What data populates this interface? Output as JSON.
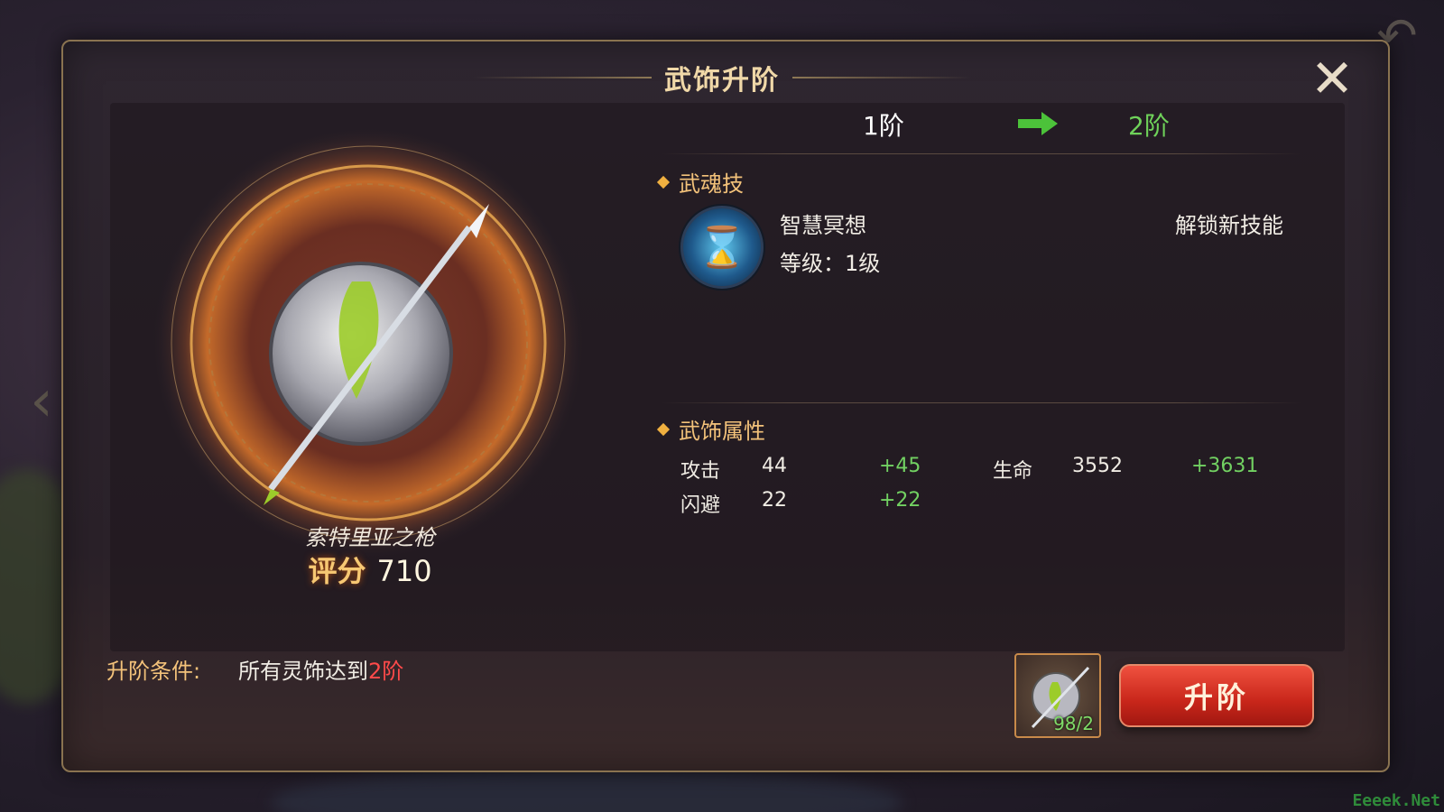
{
  "title": "武饰升阶",
  "stage": {
    "from": "1阶",
    "to": "2阶"
  },
  "item": {
    "name": "索特里亚之枪",
    "score_label": "评分",
    "score_value": "710"
  },
  "skill_section": {
    "heading": "武魂技",
    "skill_name": "智慧冥想",
    "skill_level": "等级：1级",
    "unlock_text": "解锁新技能",
    "icon": "hourglass-icon"
  },
  "attr_section": {
    "heading": "武饰属性",
    "rows": [
      {
        "name": "攻击",
        "value": "44",
        "bonus": "+45"
      },
      {
        "name": "闪避",
        "value": "22",
        "bonus": "+22"
      },
      {
        "name": "生命",
        "value": "3552",
        "bonus": "+3631"
      }
    ]
  },
  "condition": {
    "label": "升阶条件:",
    "text": "所有灵饰达到",
    "highlight": "2阶"
  },
  "material": {
    "count": "98/2"
  },
  "upgrade_button": "升阶",
  "watermark": "Eeeek.Net",
  "colors": {
    "accent_gold": "#f3c27a",
    "green": "#72d162",
    "red_button": "#c8261a"
  }
}
